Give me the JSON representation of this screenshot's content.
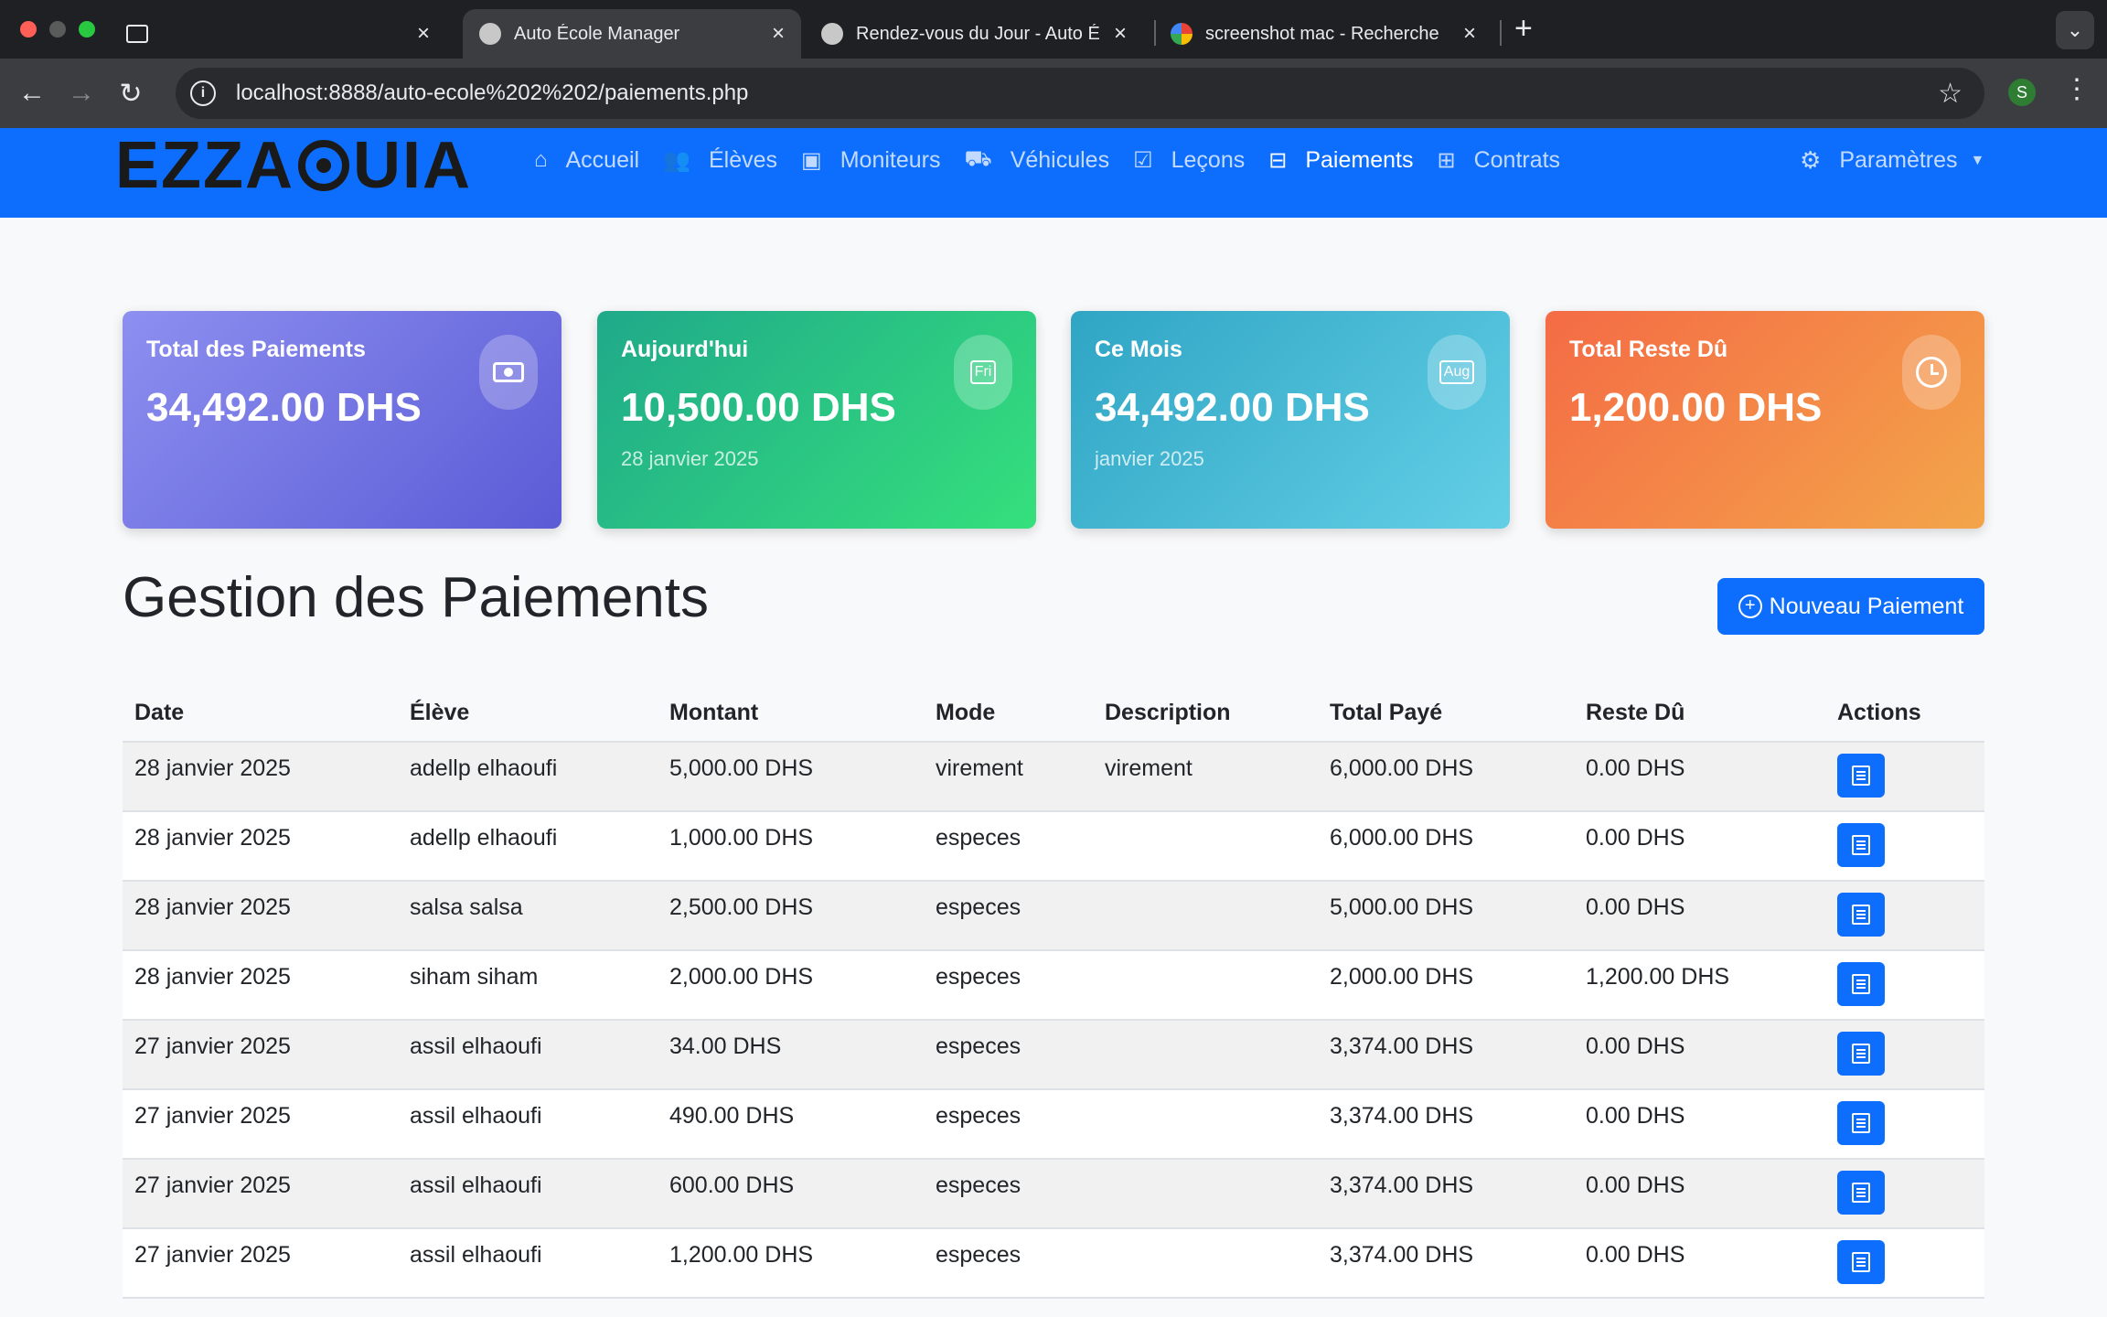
{
  "browser": {
    "tabs": [
      {
        "title": "",
        "active": false
      },
      {
        "title": "Auto École Manager",
        "active": true
      },
      {
        "title": "Rendez-vous du Jour - Auto É",
        "active": false
      },
      {
        "title": "screenshot mac - Recherche",
        "active": false
      }
    ],
    "new_tab": "+",
    "url": "localhost:8888/auto-ecole%202%202/paiements.php",
    "profile_initial": "S"
  },
  "navbar": {
    "brand": "EZZA",
    "brand_suffix": "UIA",
    "links": [
      {
        "label": "Accueil",
        "icon": "house-icon",
        "active": false
      },
      {
        "label": "Élèves",
        "icon": "people-icon",
        "active": false
      },
      {
        "label": "Moniteurs",
        "icon": "badge-icon",
        "active": false
      },
      {
        "label": "Véhicules",
        "icon": "car-icon",
        "active": false
      },
      {
        "label": "Leçons",
        "icon": "calendar-check-icon",
        "active": false
      },
      {
        "label": "Paiements",
        "icon": "cash-icon",
        "active": true
      },
      {
        "label": "Contrats",
        "icon": "contract-icon",
        "active": false
      }
    ],
    "settings": "Paramètres"
  },
  "stats": [
    {
      "label": "Total des Paiements",
      "value": "34,492.00 DHS",
      "sub": "",
      "icon": "cash-icon"
    },
    {
      "label": "Aujourd'hui",
      "value": "10,500.00 DHS",
      "sub": "28 janvier 2025",
      "icon": "calendar-day-icon",
      "icon_text": "Fri"
    },
    {
      "label": "Ce Mois",
      "value": "34,492.00 DHS",
      "sub": "janvier 2025",
      "icon": "calendar-month-icon",
      "icon_text": "Aug"
    },
    {
      "label": "Total Reste Dû",
      "value": "1,200.00 DHS",
      "sub": "",
      "icon": "clock-icon"
    }
  ],
  "page": {
    "title": "Gestion des Paiements",
    "add_button": "Nouveau Paiement"
  },
  "table": {
    "headers": [
      "Date",
      "Élève",
      "Montant",
      "Mode",
      "Description",
      "Total Payé",
      "Reste Dû",
      "Actions"
    ],
    "rows": [
      [
        "28 janvier 2025",
        "adellp elhaoufi",
        "5,000.00 DHS",
        "virement",
        "virement",
        "6,000.00 DHS",
        "0.00 DHS"
      ],
      [
        "28 janvier 2025",
        "adellp elhaoufi",
        "1,000.00 DHS",
        "especes",
        "",
        "6,000.00 DHS",
        "0.00 DHS"
      ],
      [
        "28 janvier 2025",
        "salsa salsa",
        "2,500.00 DHS",
        "especes",
        "",
        "5,000.00 DHS",
        "0.00 DHS"
      ],
      [
        "28 janvier 2025",
        "siham siham",
        "2,000.00 DHS",
        "especes",
        "",
        "2,000.00 DHS",
        "1,200.00 DHS"
      ],
      [
        "27 janvier 2025",
        "assil elhaoufi",
        "34.00 DHS",
        "especes",
        "",
        "3,374.00 DHS",
        "0.00 DHS"
      ],
      [
        "27 janvier 2025",
        "assil elhaoufi",
        "490.00 DHS",
        "especes",
        "",
        "3,374.00 DHS",
        "0.00 DHS"
      ],
      [
        "27 janvier 2025",
        "assil elhaoufi",
        "600.00 DHS",
        "especes",
        "",
        "3,374.00 DHS",
        "0.00 DHS"
      ],
      [
        "27 janvier 2025",
        "assil elhaoufi",
        "1,200.00 DHS",
        "especes",
        "",
        "3,374.00 DHS",
        "0.00 DHS"
      ]
    ]
  },
  "colors": {
    "primary": "#0d6efd",
    "chrome_dark": "#1f2023",
    "chrome_toolbar": "#3c3d41"
  }
}
